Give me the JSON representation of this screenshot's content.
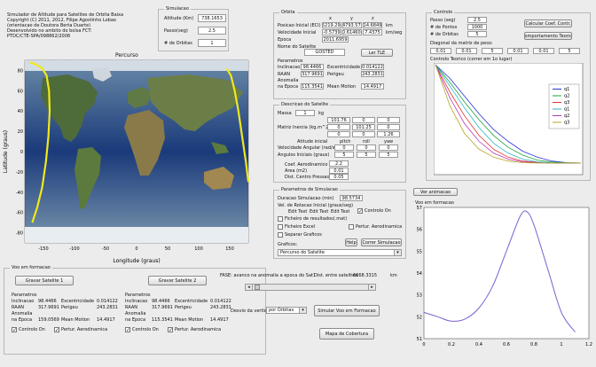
{
  "header": {
    "lines": [
      "Simulador de Altitude para Satelites de Orbita Baixa",
      "Copyright (C) 2011, 2012, Filipe Agostinho Lobao",
      "(orientacao de Doutora Berta Duarte)",
      "Desenvolvido no ambito do bolsa FCT:",
      "PTDC/CTE-SPA/098862/2008"
    ]
  },
  "simulacao": {
    "title": "Simulacao",
    "altitude_label": "Altitude (Km)",
    "altitude_value": "738.1653",
    "passo_label": "Passo(seg)",
    "passo_value": "2.5",
    "orbitas_label": "# de Orbitas",
    "orbitas_value": "1"
  },
  "orbita": {
    "title": "Orbita",
    "col_x": "x",
    "col_y": "y",
    "col_z": "z",
    "pos_label": "Posicao Inicial (ECI)",
    "pos_values": [
      "-5219.294",
      "-4793.577",
      "14.6849"
    ],
    "pos_unit": "km",
    "vel_label": "Velocidade Inicial",
    "vel_values": [
      "-0.5739",
      "-0.614605",
      "7.4375"
    ],
    "vel_unit": "km/seg",
    "epoca_label": "Epoca",
    "epoca_value": "2011.6959",
    "nome_label": "Nome do Satelite",
    "nome_value": "GOSTED",
    "ler_tle_label": "Ler TLE",
    "parametros_label": "Parametros",
    "inclinacao_label": "Inclinacao",
    "inclinacao_value": "98.4466",
    "raan_label": "RAAN",
    "raan_value": "317.9691",
    "anomalia_label_1": "Anomalia",
    "anomalia_label_2": "na Epoca",
    "anomalia_value": "115.3541",
    "excentricidade_label": "Excentricidade",
    "excentricidade_value": "0.014122",
    "perigeu_label": "Perigeu",
    "perigeu_value": "243.2831",
    "mean_motion_label": "Mean Motion",
    "mean_motion_value": "14.4917"
  },
  "controlo": {
    "title": "Controlo",
    "passo_label": "Passo (seg)",
    "passo_value": "2.5",
    "pontos_label": "# de Pontos",
    "pontos_value": "1000",
    "orbitas_label": "# de Orbitas",
    "orbitas_value": "5",
    "calc_button": "Calcular Coef. Contr.",
    "comport_button": "Comportamento Teorico",
    "diag_label": "Diagonal da matriz de peso:",
    "diag_values": [
      "0.01",
      "0.01",
      "5",
      "0.01",
      "0.01",
      "5"
    ],
    "graph_title": "Controlo Teorico (correr em 1o lugar)",
    "legend": [
      "q1",
      "q2",
      "q3",
      "q1",
      "q2",
      "q3"
    ]
  },
  "map": {
    "title": "Percurso",
    "xlabel": "Longitude (graus)",
    "ylabel": "Latitude (graus)",
    "xticks": [
      "-150",
      "-100",
      "-50",
      "0",
      "50",
      "100",
      "150"
    ],
    "yticks": [
      "80",
      "60",
      "40",
      "20",
      "0",
      "-20",
      "-40",
      "-60",
      "-80"
    ]
  },
  "descricao": {
    "title": "Descricao do Satelite",
    "massa_label": "Massa",
    "massa_value": "1",
    "massa_unit": "kg",
    "inercia_label": "Matriz Inercia (kg.m^2)",
    "inercia_rows": [
      [
        "101.76",
        "0",
        "0"
      ],
      [
        "0",
        "101.25",
        "0"
      ],
      [
        "0",
        "0",
        "1.26"
      ]
    ],
    "atitude_label": "Atitude inicial",
    "pitch": "pitch",
    "roll": "roll",
    "yaw": "yaw",
    "vel_ang_label": "Velocidade Angular (rad/s)",
    "vel_ang_values": [
      "0",
      "0",
      "0"
    ],
    "angulos_label": "Angulos Iniciais (graus)",
    "angulos_values": [
      "5",
      "5",
      "5"
    ],
    "coef_label": "Coef. Aerodinamico",
    "coef_value": "2.2",
    "area_label": "Area (m2)",
    "area_value": "0.01",
    "dist_label": "Dist. Centro Pressao (m)",
    "dist_value": "0.05"
  },
  "parametros_sim": {
    "title": "Parametros de Simulacao",
    "duracao_label": "Duracao Simulacao (min)",
    "duracao_value": "98.5734",
    "rotacao_label": "Vel. de Rotacao Inicial (graus/seg)",
    "edit_labels": [
      "Edit Text",
      "Edit Text",
      "Edit Text"
    ],
    "controlo_on_label": "Controlo On",
    "ficheiro_resultados": "Ficheiro de resultados(.mat)",
    "ficheiro_excel": "Ficheiro Excel",
    "separar_graficos": "Separar Graficos",
    "perturb_label": "Pertur. Aerodinamica",
    "help_label": "Help",
    "correr_label": "Correr Simulacao",
    "graficos_label": "Graficos:",
    "graficos_value": "Percurso do Satelite"
  },
  "voo": {
    "title": "Voo em formacao",
    "gravar1": "Gravar Satelite 1",
    "gravar2": "Gravar Satelite 2",
    "sat1": {
      "parametros": "Parametros",
      "inclinacao": "98.4466",
      "raan": "317.9691",
      "anomalia": "159.0569",
      "excentricidade": "0.014122",
      "perigeu": "243.2831",
      "mean_motion": "14.4917"
    },
    "sat2": {
      "parametros": "Parametros",
      "inclinacao": "98.4466",
      "raan": "317.9691",
      "anomalia": "115.3541",
      "excentricidade": "0.014122",
      "perigeu": "243.2831",
      "mean_motion": "14.4917"
    },
    "labels": {
      "inclinacao": "Inclinacao",
      "raan": "RAAN",
      "anomalia_1": "Anomalia",
      "anomalia_2": "na Epoca",
      "excentricidade": "Excentricidade",
      "perigeu": "Perigeu",
      "mean_motion": "Mean Motion"
    },
    "controlo_on": "Controlo On",
    "perturb": "Pertur. Aerodinamica",
    "fase_label": "FASE: avanco na anomalia a epoca do Sat1",
    "dist_label": "Dist. entre satelites:",
    "dist_value": "6668.3315",
    "dist_unit": "km",
    "desvio_label": "Desvio da vertical:",
    "desvio_value": "por Orbitas",
    "simular_label": "Simular Voo em Formacao",
    "mapa_label": "Mapa de Cobertura",
    "animacao_label": "Ver animacao",
    "graph_title": "Voo em formacao",
    "xticks": [
      "0",
      "0.2",
      "0.4",
      "0.6",
      "0.8",
      "1",
      "1.2"
    ],
    "yticks": [
      "57",
      "56",
      "55",
      "54",
      "53",
      "52",
      "51"
    ]
  },
  "colors": {
    "q1": "#2a35d8",
    "q2": "#22a33a",
    "q3": "#e0352a",
    "q4": "#27b8c8",
    "q5": "#b838b8",
    "q6": "#b8a420",
    "track": "#f0e81a",
    "formation": "#7b5fd0"
  },
  "chart_data": [
    {
      "type": "line",
      "title": "Controlo Teorico (correr em 1o lugar)",
      "x": [
        0,
        0.1,
        0.2,
        0.3,
        0.4,
        0.5,
        0.6,
        0.7,
        0.8,
        0.9,
        1.0
      ],
      "series": [
        {
          "name": "q1",
          "values": [
            5,
            4.3,
            3.4,
            2.5,
            1.7,
            1.1,
            0.6,
            0.3,
            0.1,
            0.02,
            0
          ]
        },
        {
          "name": "q2",
          "values": [
            5,
            4.1,
            3.1,
            2.2,
            1.4,
            0.8,
            0.4,
            0.15,
            0.05,
            0.01,
            0
          ]
        },
        {
          "name": "q3",
          "values": [
            5,
            3.6,
            2.4,
            1.4,
            0.7,
            0.3,
            0.1,
            0.03,
            0,
            0,
            0
          ]
        },
        {
          "name": "q1",
          "values": [
            5,
            3.9,
            2.8,
            1.8,
            1.0,
            0.5,
            0.2,
            0.06,
            0.01,
            0,
            0
          ]
        },
        {
          "name": "q2",
          "values": [
            5,
            3.3,
            2.0,
            1.1,
            0.5,
            0.2,
            0.06,
            0.01,
            0,
            0,
            0
          ]
        },
        {
          "name": "q3",
          "values": [
            5,
            2.9,
            1.5,
            0.7,
            0.3,
            0.1,
            0.02,
            0,
            0,
            0,
            0
          ]
        }
      ],
      "ylim": [
        -0.5,
        5
      ]
    },
    {
      "type": "line",
      "title": "Voo em formacao",
      "x": [
        0,
        0.1,
        0.2,
        0.3,
        0.4,
        0.5,
        0.6,
        0.7,
        0.75,
        0.8,
        0.9,
        1.0,
        1.1
      ],
      "series": [
        {
          "name": "",
          "values": [
            52.2,
            52.0,
            51.8,
            51.9,
            52.4,
            53.4,
            55.0,
            56.6,
            56.8,
            56.2,
            54.2,
            52.2,
            51.3
          ]
        }
      ],
      "xlim": [
        0,
        1.2
      ],
      "ylim": [
        51,
        57
      ]
    },
    {
      "type": "line",
      "title": "Percurso",
      "xlabel": "Longitude (graus)",
      "ylabel": "Latitude (graus)",
      "xlim": [
        -180,
        180
      ],
      "ylim": [
        -90,
        90
      ],
      "series": [
        {
          "name": "",
          "x": [
            -168,
            -160,
            -152,
            -146,
            -142,
            -140,
            -141,
            -145,
            -152,
            -162,
            -172
          ],
          "values": [
            -70,
            -55,
            -35,
            -10,
            15,
            40,
            60,
            75,
            82,
            86,
            88
          ]
        },
        {
          "name": "",
          "x": [
            145,
            152,
            158,
            164,
            170,
            176,
            180
          ],
          "values": [
            82,
            75,
            60,
            40,
            15,
            -10,
            -30
          ]
        }
      ]
    }
  ]
}
